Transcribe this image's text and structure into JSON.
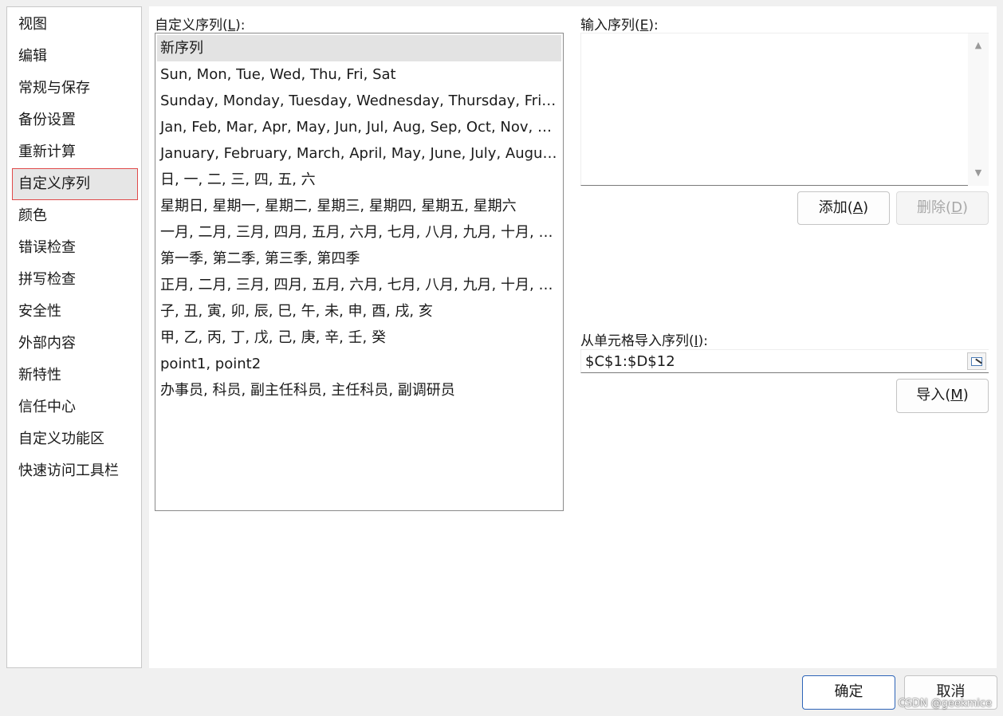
{
  "sidebar": {
    "items": [
      {
        "label": "视图"
      },
      {
        "label": "编辑"
      },
      {
        "label": "常规与保存"
      },
      {
        "label": "备份设置"
      },
      {
        "label": "重新计算"
      },
      {
        "label": "自定义序列",
        "selected": true
      },
      {
        "label": "颜色"
      },
      {
        "label": "错误检查"
      },
      {
        "label": "拼写检查"
      },
      {
        "label": "安全性"
      },
      {
        "label": "外部内容"
      },
      {
        "label": "新特性"
      },
      {
        "label": "信任中心"
      },
      {
        "label": "自定义功能区"
      },
      {
        "label": "快速访问工具栏"
      }
    ]
  },
  "custom_lists": {
    "label": "自定义序列(",
    "label_key": "L",
    "label_end": "):",
    "items": [
      "新序列",
      "Sun, Mon, Tue, Wed, Thu, Fri, Sat",
      "Sunday, Monday, Tuesday, Wednesday, Thursday, Frida...",
      "Jan, Feb, Mar, Apr, May, Jun, Jul, Aug, Sep, Oct, Nov, Dec",
      "January, February, March, April, May, June, July, August, ...",
      "日, 一, 二, 三, 四, 五, 六",
      "星期日, 星期一, 星期二, 星期三, 星期四, 星期五, 星期六",
      "一月, 二月, 三月, 四月, 五月, 六月, 七月, 八月, 九月, 十月, 十...",
      "第一季, 第二季, 第三季, 第四季",
      "正月, 二月, 三月, 四月, 五月, 六月, 七月, 八月, 九月, 十月, 十...",
      "子, 丑, 寅, 卯, 辰, 巳, 午, 未, 申, 酉, 戌, 亥",
      "甲, 乙, 丙, 丁, 戊, 己, 庚, 辛, 壬, 癸",
      "point1, point2",
      "办事员, 科员, 副主任科员, 主任科员, 副调研员"
    ],
    "selected_index": 0
  },
  "entries": {
    "label": "输入序列(",
    "label_key": "E",
    "label_end": "):",
    "value": ""
  },
  "buttons": {
    "add": {
      "label": "添加(",
      "key": "A",
      "end": ")"
    },
    "delete": {
      "label": "删除(",
      "key": "D",
      "end": ")",
      "disabled": true
    },
    "import": {
      "label": "导入(",
      "key": "M",
      "end": ")"
    },
    "ok": {
      "label": "确定"
    },
    "cancel": {
      "label": "取消"
    }
  },
  "import_range": {
    "label": "从单元格导入序列(",
    "label_key": "I",
    "label_end": "):",
    "value": "$C$1:$D$12"
  },
  "icons": {
    "scroll_up": "scroll-up-arrow",
    "scroll_down": "scroll-down-arrow",
    "range_picker": "range-select-icon"
  },
  "watermark": "CSDN @geekmice",
  "colors": {
    "selected_border": "#e04a4a",
    "primary_border": "#2d64b8"
  }
}
